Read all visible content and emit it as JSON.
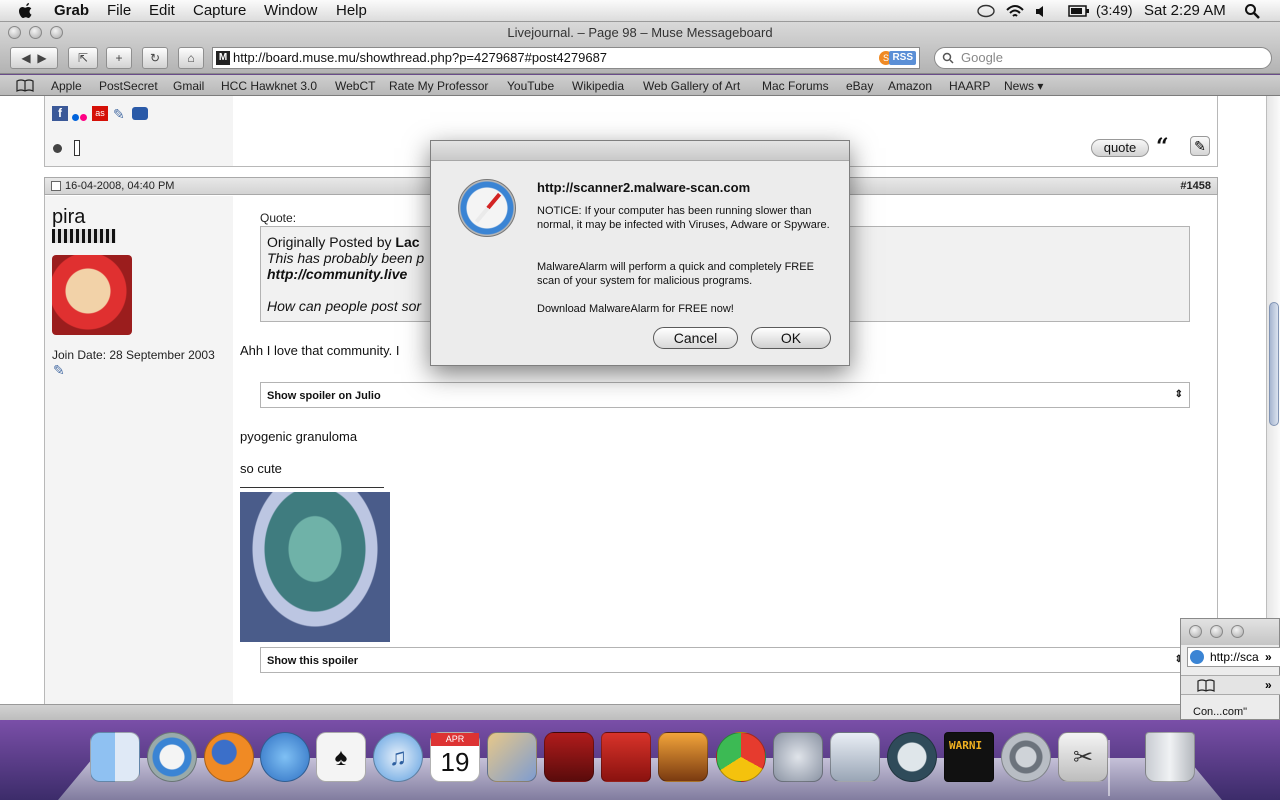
{
  "menubar": {
    "app": "Grab",
    "items": [
      "File",
      "Edit",
      "Capture",
      "Window",
      "Help"
    ],
    "battery": "(3:49)",
    "clock": "Sat 2:29 AM"
  },
  "window": {
    "title": "Livejournal. – Page 98 – Muse Messageboard",
    "url": "http://board.muse.mu/showthread.php?p=4279687#post4279687",
    "url_favicon": "M",
    "rss": "RSS",
    "search_placeholder": "Google"
  },
  "bookmarks": [
    "Apple",
    "PostSecret",
    "Gmail",
    "HCC Hawknet 3.0",
    "WebCT",
    "Rate My Professor",
    "YouTube",
    "Wikipedia",
    "Web Gallery of Art",
    "Mac Forums",
    "eBay",
    "Amazon",
    "HAARP",
    "News ▾"
  ],
  "post": {
    "quote_button": "quote",
    "date": "16-04-2008, 04:40 PM",
    "number": "#1458",
    "username": "pira",
    "join_date": "Join Date: 28 September 2003",
    "quote_label": "Quote:",
    "quote_by_prefix": "Originally Posted by",
    "quote_by_name": "Lac",
    "quote_line1": "This has probably been p",
    "quote_line2": "http://community.live",
    "quote_line3": "How can people post sor",
    "body1": "Ahh I love that community. I",
    "spoiler1": "Show spoiler on Julio",
    "body2": "pyogenic granuloma",
    "body3": "so cute",
    "spoiler2": "Show this spoiler"
  },
  "dialog": {
    "heading": "http://scanner2.malware-scan.com",
    "msg1": "NOTICE: If your computer has been running slower than normal, it may be infected with Viruses, Adware or Spyware.",
    "msg2": "MalwareAlarm will perform a quick and completely FREE scan of your system for malicious programs.",
    "msg3": "Download MalwareAlarm for FREE now!",
    "cancel": "Cancel",
    "ok": "OK"
  },
  "miniwin": {
    "url": "http://sca",
    "label": "Con...com\""
  },
  "dock": {
    "ical_month": "APR",
    "ical_day": "19",
    "console_text": "WARNI"
  }
}
